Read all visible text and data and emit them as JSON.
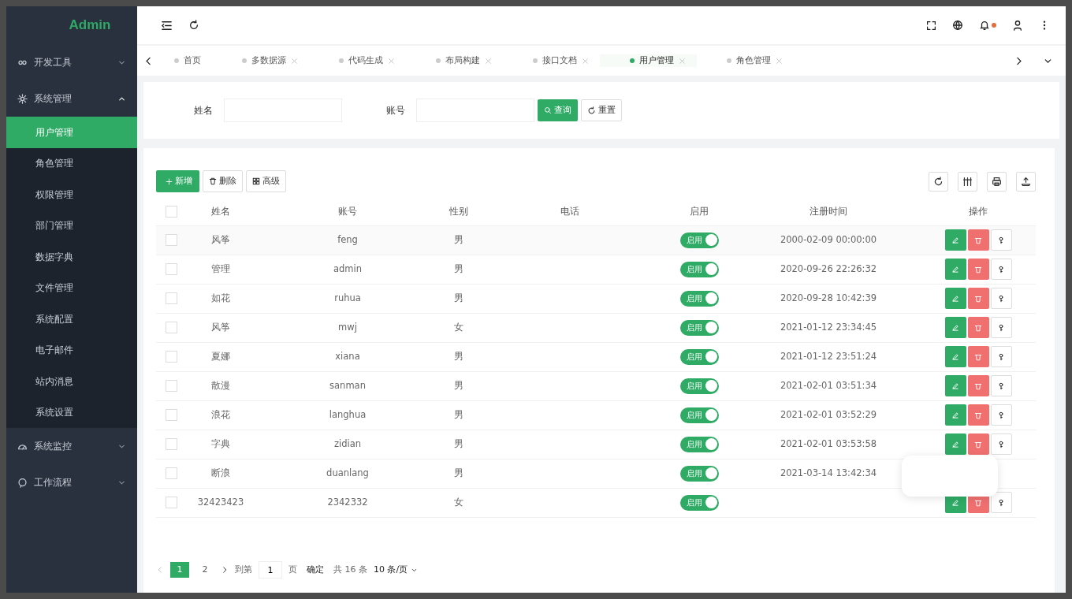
{
  "sidebar": {
    "logo": "Admin",
    "groups": [
      {
        "label": "开发工具",
        "expanded": false
      },
      {
        "label": "系统管理",
        "expanded": true,
        "children": [
          {
            "label": "用户管理",
            "selected": true
          },
          {
            "label": "角色管理",
            "selected": false
          },
          {
            "label": "权限管理",
            "selected": false
          },
          {
            "label": "部门管理",
            "selected": false
          },
          {
            "label": "数据字典",
            "selected": false
          },
          {
            "label": "文件管理",
            "selected": false
          },
          {
            "label": "系统配置",
            "selected": false
          },
          {
            "label": "电子邮件",
            "selected": false
          },
          {
            "label": "站内消息",
            "selected": false
          },
          {
            "label": "系统设置",
            "selected": false
          }
        ]
      },
      {
        "label": "系统监控",
        "expanded": false
      },
      {
        "label": "工作流程",
        "expanded": false
      }
    ]
  },
  "header": {
    "notification_dot": true
  },
  "tabs": [
    {
      "label": "首页",
      "selected": false,
      "closable": false
    },
    {
      "label": "多数据源",
      "selected": false,
      "closable": true
    },
    {
      "label": "代码生成",
      "selected": false,
      "closable": true
    },
    {
      "label": "布局构建",
      "selected": false,
      "closable": true
    },
    {
      "label": "接口文档",
      "selected": false,
      "closable": true
    },
    {
      "label": "用户管理",
      "selected": true,
      "closable": true
    },
    {
      "label": "角色管理",
      "selected": false,
      "closable": true
    }
  ],
  "search": {
    "fields": [
      {
        "label": "姓名"
      },
      {
        "label": "账号"
      }
    ],
    "search_button": "查询",
    "reset_button": "重置"
  },
  "toolbar": {
    "add": "新增",
    "delete": "删除",
    "advanced": "高级"
  },
  "table": {
    "header_checked": false,
    "columns": [
      "姓名",
      "账号",
      "性别",
      "电话",
      "启用",
      "注册时间",
      "操作"
    ],
    "rows": [
      {
        "checked": false,
        "name": "风筝",
        "account": "feng",
        "gender": "男",
        "enabled": true,
        "switch_label": "启用",
        "registered": "2000-02-09 00:00:00",
        "actions_shown": true
      },
      {
        "checked": false,
        "name": "管理",
        "account": "admin",
        "gender": "男",
        "enabled": true,
        "switch_label": "启用",
        "registered": "2020-09-26 22:26:32",
        "actions_shown": true
      },
      {
        "checked": false,
        "name": "如花",
        "account": "ruhua",
        "gender": "男",
        "enabled": true,
        "switch_label": "启用",
        "registered": "2020-09-28 10:42:39",
        "actions_shown": true
      },
      {
        "checked": false,
        "name": "风筝",
        "account": "mwj",
        "gender": "女",
        "enabled": true,
        "switch_label": "启用",
        "registered": "2021-01-12 23:34:45",
        "actions_shown": true
      },
      {
        "checked": false,
        "name": "夏娜",
        "account": "xiana",
        "gender": "男",
        "enabled": true,
        "switch_label": "启用",
        "registered": "2021-01-12 23:51:24",
        "actions_shown": true
      },
      {
        "checked": false,
        "name": "散漫",
        "account": "sanman",
        "gender": "男",
        "enabled": true,
        "switch_label": "启用",
        "registered": "2021-02-01 03:51:34",
        "actions_shown": true
      },
      {
        "checked": false,
        "name": "浪花",
        "account": "langhua",
        "gender": "男",
        "enabled": true,
        "switch_label": "启用",
        "registered": "2021-02-01 03:52:29",
        "actions_shown": true
      },
      {
        "checked": false,
        "name": "字典",
        "account": "zidian",
        "gender": "男",
        "enabled": true,
        "switch_label": "启用",
        "registered": "2021-02-01 03:53:58",
        "actions_shown": true
      },
      {
        "checked": false,
        "name": "断浪",
        "account": "duanlang",
        "gender": "男",
        "enabled": true,
        "switch_label": "启用",
        "registered": "2021-03-14 13:42:34",
        "actions_shown": false
      },
      {
        "checked": false,
        "name": "32423423",
        "account": "2342332",
        "gender": "女",
        "enabled": true,
        "switch_label": "启用",
        "actions_shown": true
      }
    ]
  },
  "pagination": {
    "pages": [
      {
        "label": "1",
        "selected": true
      },
      {
        "label": "2",
        "selected": false
      }
    ],
    "goto_label": "到第",
    "page_value": "1",
    "page_unit": "页",
    "confirm": "确定",
    "total": "共 16 条",
    "page_size": "10 条/页"
  },
  "popup": {
    "visible": true
  }
}
